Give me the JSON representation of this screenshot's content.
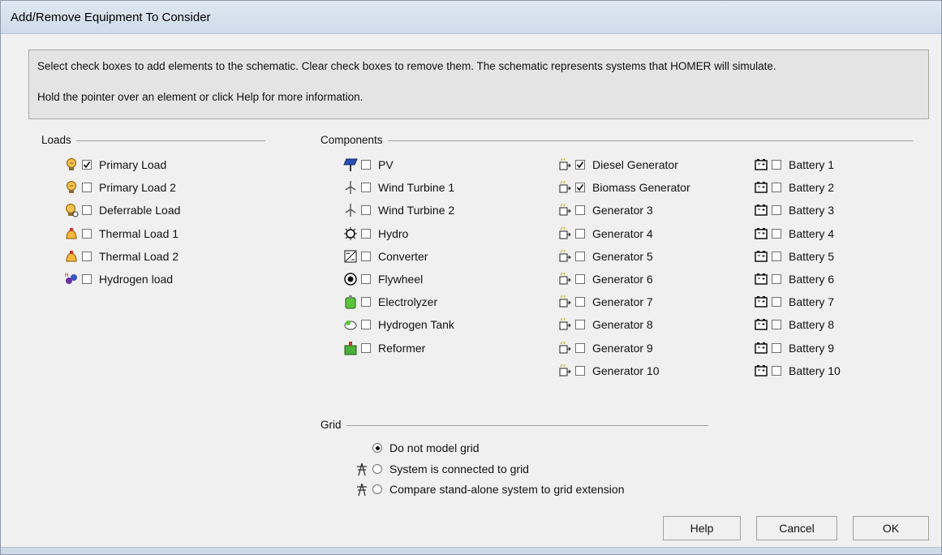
{
  "window": {
    "title": "Add/Remove Equipment To Consider"
  },
  "info": {
    "line1": "Select check boxes to add elements to the schematic. Clear check boxes to remove them. The schematic represents systems that HOMER will simulate.",
    "line2": "Hold the pointer over an element or click Help for more information."
  },
  "loads": {
    "label": "Loads",
    "items": [
      {
        "label": "Primary Load",
        "checked": true,
        "icon": "primary-load-icon"
      },
      {
        "label": "Primary Load 2",
        "checked": false,
        "icon": "primary-load-icon"
      },
      {
        "label": "Deferrable Load",
        "checked": false,
        "icon": "deferrable-load-icon"
      },
      {
        "label": "Thermal Load 1",
        "checked": false,
        "icon": "thermal-load-icon"
      },
      {
        "label": "Thermal Load 2",
        "checked": false,
        "icon": "thermal-load-icon"
      },
      {
        "label": "Hydrogen load",
        "checked": false,
        "icon": "hydrogen-load-icon"
      }
    ]
  },
  "components": {
    "label": "Components",
    "col1": [
      {
        "label": "PV",
        "checked": false,
        "icon": "pv-icon"
      },
      {
        "label": "Wind Turbine 1",
        "checked": false,
        "icon": "wind-turbine-icon"
      },
      {
        "label": "Wind Turbine 2",
        "checked": false,
        "icon": "wind-turbine-icon"
      },
      {
        "label": "Hydro",
        "checked": false,
        "icon": "hydro-icon"
      },
      {
        "label": "Converter",
        "checked": false,
        "icon": "converter-icon"
      },
      {
        "label": "Flywheel",
        "checked": false,
        "icon": "flywheel-icon"
      },
      {
        "label": "Electrolyzer",
        "checked": false,
        "icon": "electrolyzer-icon"
      },
      {
        "label": "Hydrogen Tank",
        "checked": false,
        "icon": "hydrogen-tank-icon"
      },
      {
        "label": "Reformer",
        "checked": false,
        "icon": "reformer-icon"
      }
    ],
    "col2": [
      {
        "label": "Diesel Generator",
        "checked": true,
        "icon": "generator-icon"
      },
      {
        "label": "Biomass Generator",
        "checked": true,
        "icon": "generator-icon"
      },
      {
        "label": "Generator 3",
        "checked": false,
        "icon": "generator-icon"
      },
      {
        "label": "Generator 4",
        "checked": false,
        "icon": "generator-icon"
      },
      {
        "label": "Generator 5",
        "checked": false,
        "icon": "generator-icon"
      },
      {
        "label": "Generator 6",
        "checked": false,
        "icon": "generator-icon"
      },
      {
        "label": "Generator 7",
        "checked": false,
        "icon": "generator-icon"
      },
      {
        "label": "Generator 8",
        "checked": false,
        "icon": "generator-icon"
      },
      {
        "label": "Generator 9",
        "checked": false,
        "icon": "generator-icon"
      },
      {
        "label": "Generator 10",
        "checked": false,
        "icon": "generator-icon"
      }
    ],
    "col3": [
      {
        "label": "Battery 1",
        "checked": false,
        "icon": "battery-icon"
      },
      {
        "label": "Battery 2",
        "checked": false,
        "icon": "battery-icon"
      },
      {
        "label": "Battery 3",
        "checked": false,
        "icon": "battery-icon"
      },
      {
        "label": "Battery 4",
        "checked": false,
        "icon": "battery-icon"
      },
      {
        "label": "Battery 5",
        "checked": false,
        "icon": "battery-icon"
      },
      {
        "label": "Battery 6",
        "checked": false,
        "icon": "battery-icon"
      },
      {
        "label": "Battery 7",
        "checked": false,
        "icon": "battery-icon"
      },
      {
        "label": "Battery 8",
        "checked": false,
        "icon": "battery-icon"
      },
      {
        "label": "Battery 9",
        "checked": false,
        "icon": "battery-icon"
      },
      {
        "label": "Battery 10",
        "checked": false,
        "icon": "battery-icon"
      }
    ]
  },
  "grid": {
    "label": "Grid",
    "options": [
      {
        "label": "Do not model grid",
        "selected": true,
        "icon": ""
      },
      {
        "label": "System is connected to grid",
        "selected": false,
        "icon": "grid-tower-icon"
      },
      {
        "label": "Compare stand-alone system to grid extension",
        "selected": false,
        "icon": "grid-tower-icon"
      }
    ]
  },
  "buttons": {
    "help": "Help",
    "cancel": "Cancel",
    "ok": "OK"
  }
}
